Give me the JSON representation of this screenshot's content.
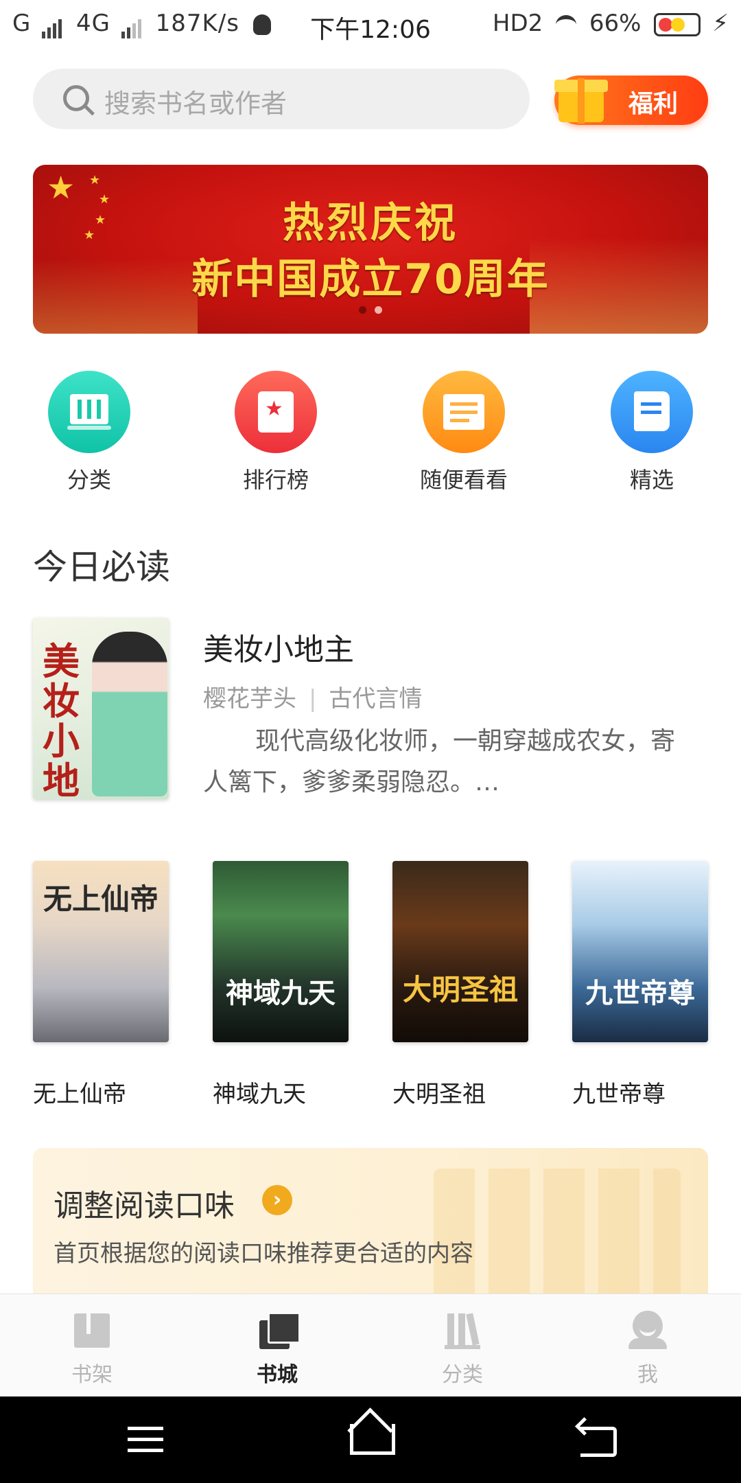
{
  "status_bar": {
    "carrier1": "G",
    "carrier2": "4G",
    "speed": "187K/s",
    "time": "下午12:06",
    "hd": "HD2",
    "battery": "66%"
  },
  "search": {
    "placeholder": "搜索书名或作者",
    "welfare_label": "福利"
  },
  "banner": {
    "line1": "热烈庆祝",
    "line2": "新中国成立70周年",
    "page_count": 2,
    "active_page": 1
  },
  "quick_nav": [
    {
      "label": "分类",
      "icon": "books-icon"
    },
    {
      "label": "排行榜",
      "icon": "ranking-icon"
    },
    {
      "label": "随便看看",
      "icon": "random-book-icon"
    },
    {
      "label": "精选",
      "icon": "featured-book-icon"
    }
  ],
  "today": {
    "heading": "今日必读",
    "featured": {
      "cover_title": "美妆小地主",
      "title": "美妆小地主",
      "author": "樱花芋头",
      "separator": "|",
      "genre": "古代言情",
      "description": "现代高级化妆师，一朝穿越成农女，寄人篱下，爹爹柔弱隐忍。…"
    },
    "books": [
      {
        "title": "无上仙帝",
        "cover_text": "无上仙帝"
      },
      {
        "title": "神域九天",
        "cover_text": "神域九天"
      },
      {
        "title": "大明圣祖",
        "cover_text": "大明圣祖"
      },
      {
        "title": "九世帝尊",
        "cover_text": "九世帝尊"
      }
    ]
  },
  "taste_card": {
    "title": "调整阅读口味",
    "arrow": "›",
    "subtitle": "首页根据您的阅读口味推荐更合适的内容"
  },
  "tabs": [
    {
      "label": "书架",
      "icon": "bookshelf-icon",
      "active": false
    },
    {
      "label": "书城",
      "icon": "bookstore-icon",
      "active": true
    },
    {
      "label": "分类",
      "icon": "category-icon",
      "active": false
    },
    {
      "label": "我",
      "icon": "profile-icon",
      "active": false
    }
  ],
  "colors": {
    "accent_orange": "#ff5a14",
    "banner_red": "#c4120e",
    "taste_arrow": "#f1a91e"
  }
}
